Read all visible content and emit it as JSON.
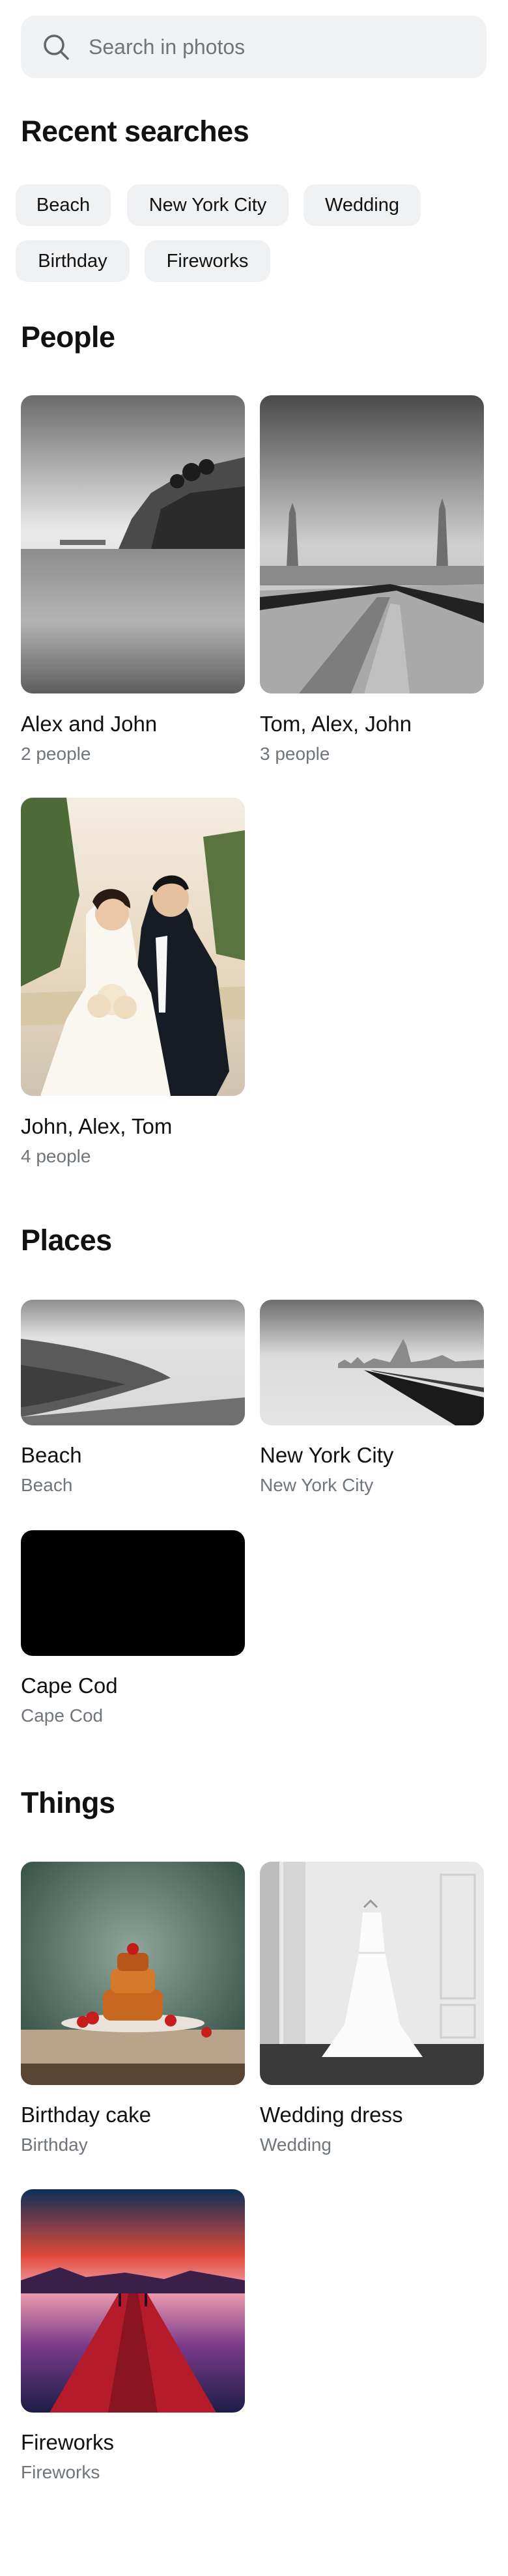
{
  "search": {
    "placeholder": "Search in photos",
    "value": ""
  },
  "recent": {
    "title": "Recent searches",
    "chips": [
      "Beach",
      "New York City",
      "Wedding",
      "Birthday",
      "Fireworks"
    ]
  },
  "people": {
    "title": "People",
    "items": [
      {
        "title": "Alex and John",
        "subtitle": "2 people"
      },
      {
        "title": "Tom, Alex, John",
        "subtitle": "3 people"
      },
      {
        "title": "John, Alex, Tom",
        "subtitle": "4 people"
      }
    ]
  },
  "places": {
    "title": "Places",
    "items": [
      {
        "title": "Beach",
        "subtitle": "Beach"
      },
      {
        "title": "New York City",
        "subtitle": "New York City"
      },
      {
        "title": "Cape Cod",
        "subtitle": "Cape Cod"
      }
    ]
  },
  "things": {
    "title": "Things",
    "items": [
      {
        "title": "Birthday cake",
        "subtitle": "Birthday"
      },
      {
        "title": "Wedding dress",
        "subtitle": "Wedding"
      },
      {
        "title": "Fireworks",
        "subtitle": "Fireworks"
      }
    ]
  }
}
